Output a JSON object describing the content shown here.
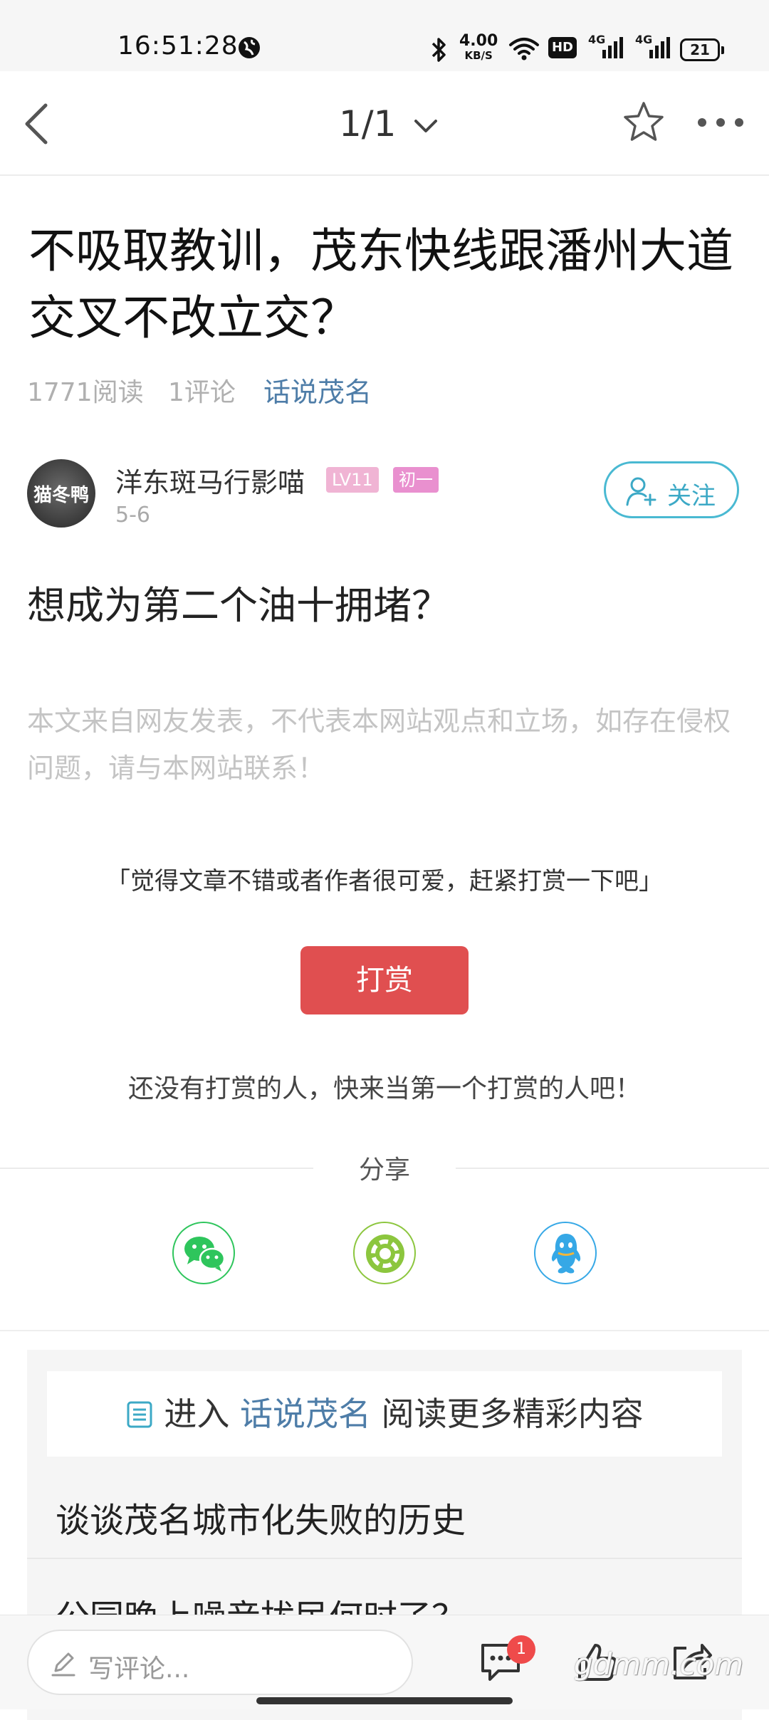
{
  "status_bar": {
    "time": "16:51:28",
    "net_speed_value": "4.00",
    "net_speed_unit": "KB/S",
    "hd_label": "HD",
    "signal_1_label": "4G",
    "signal_2_label": "4G",
    "battery": "21"
  },
  "nav": {
    "page_indicator": "1/1"
  },
  "article": {
    "title": "不吸取教训，茂东快线跟潘州大道交叉不改立交？",
    "reads": "1771阅读",
    "comments": "1评论",
    "forum": "话说茂名",
    "author": {
      "name": "洋东斑马行影喵",
      "avatar_text": "猫冬鸭",
      "level": "LV11",
      "rank": "初一",
      "date": "5-6",
      "follow_label": "关注"
    },
    "body": "想成为第二个油十拥堵？",
    "disclaimer": "本文来自网友发表，不代表本网站观点和立场，如存在侵权问题，请与本网站联系！"
  },
  "reward": {
    "prompt": "「觉得文章不错或者作者很可爱，赶紧打赏一下吧」",
    "button": "打赏",
    "empty_text": "还没有打赏的人，快来当第一个打赏的人吧！"
  },
  "share": {
    "label": "分享"
  },
  "related": {
    "enter_prefix": "进入",
    "forum": "话说茂名",
    "enter_suffix": "阅读更多精彩内容",
    "items": [
      "谈谈茂名城市化失败的历史",
      "公园晚上噪音扰民何时了？"
    ]
  },
  "bottom_bar": {
    "comment_placeholder": "写评论...",
    "comment_badge": "1",
    "watermark": "gdmm.com"
  },
  "colors": {
    "link_blue": "#4e7da8",
    "follow_cyan": "#49b9d2",
    "reward_red": "#e04f50",
    "badge_level": "#f0b4d4",
    "badge_rank": "#e990cf",
    "wechat_green": "#2ec55c",
    "moments_green": "#8cc63e",
    "qq_blue": "#36a8e6"
  }
}
